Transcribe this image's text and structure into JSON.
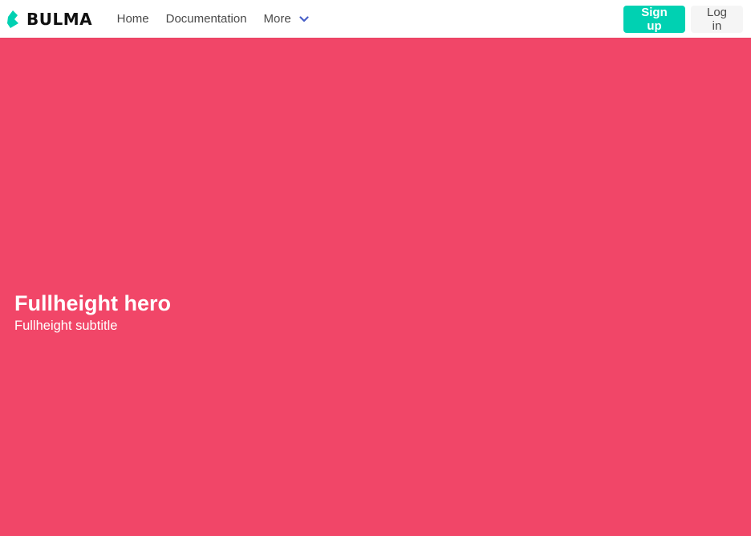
{
  "navbar": {
    "brand": {
      "icon": "bulma-logo-icon",
      "text": "BULMA",
      "color": "#00d1b2"
    },
    "items": [
      {
        "label": "Home"
      },
      {
        "label": "Documentation"
      },
      {
        "label": "More",
        "icon": "chevron-down-icon"
      }
    ],
    "buttons": {
      "signup_label": "Sign up",
      "login_label": "Log in"
    }
  },
  "hero": {
    "title": "Fullheight hero",
    "subtitle": "Fullheight subtitle",
    "background_color": "#f14668"
  },
  "colors": {
    "primary": "#00d1b2",
    "danger": "#f14668",
    "link": "#485fc7",
    "light": "#f5f5f5"
  }
}
